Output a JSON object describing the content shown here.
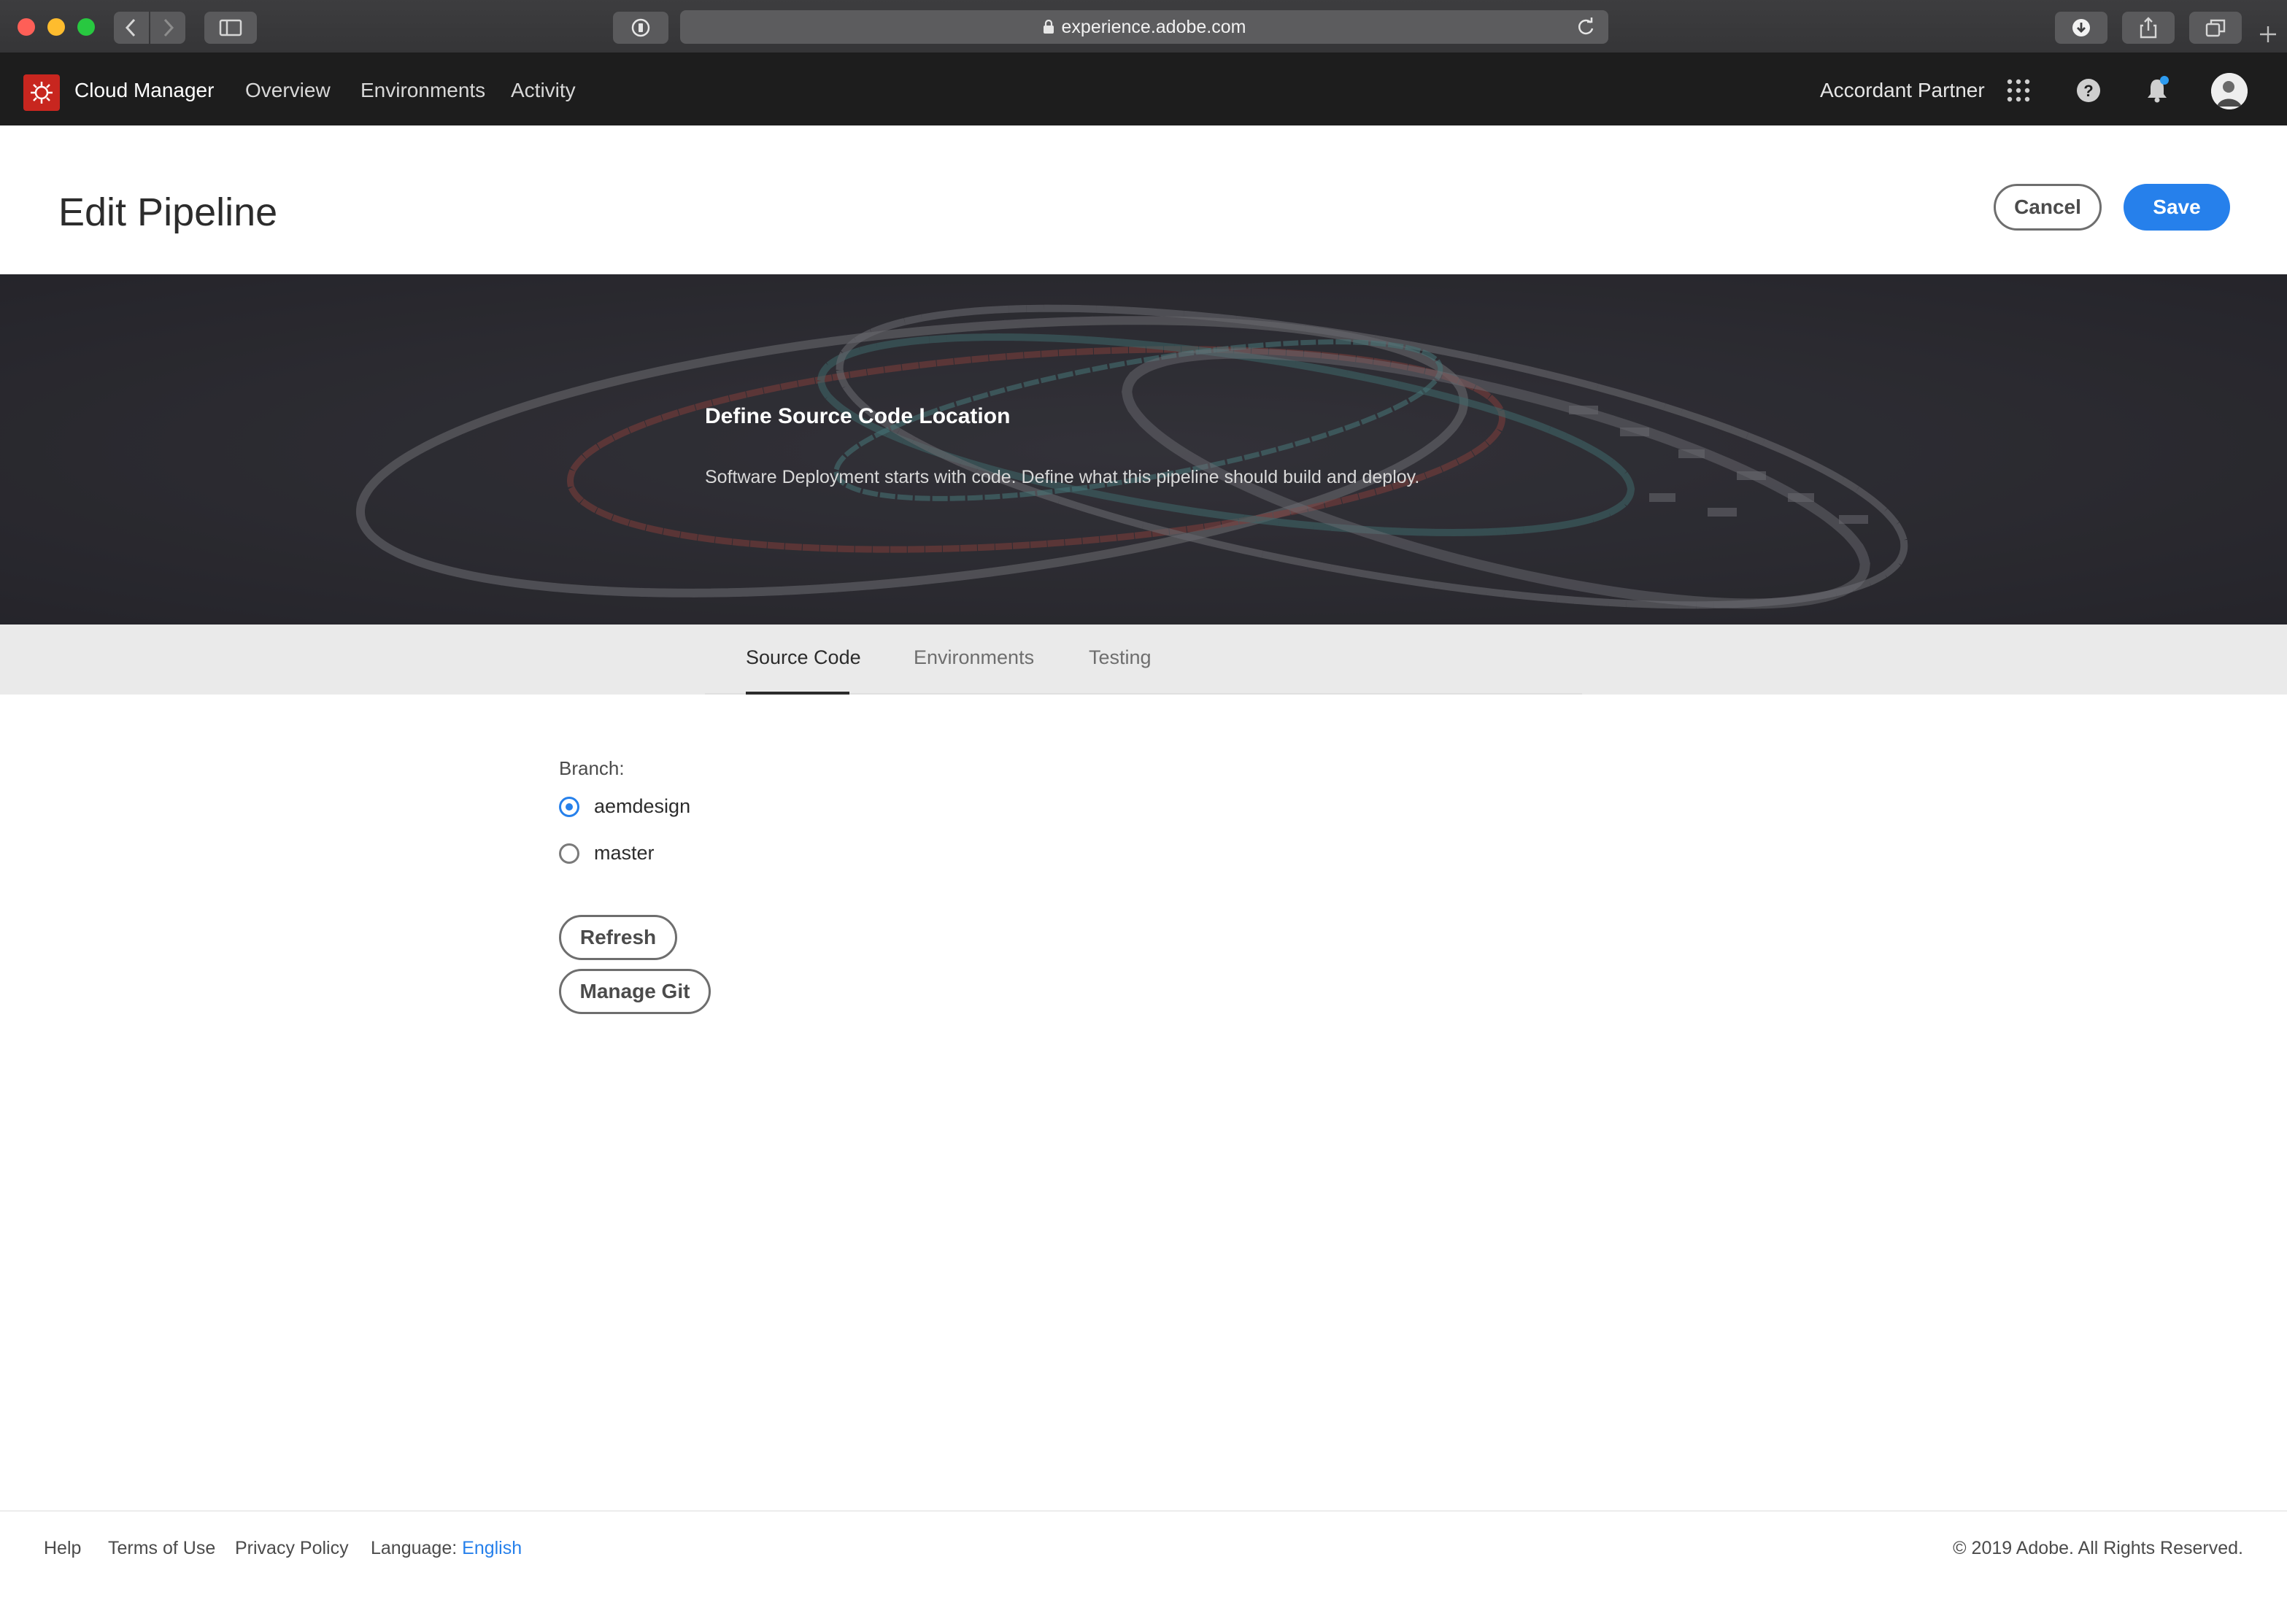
{
  "browser": {
    "url": "experience.adobe.com"
  },
  "app_nav": {
    "app_name": "Cloud Manager",
    "links": [
      "Overview",
      "Environments",
      "Activity"
    ],
    "org_name": "Accordant Partner",
    "icons": [
      "apps-grid-icon",
      "help-icon",
      "bell-icon",
      "avatar"
    ]
  },
  "header": {
    "title": "Edit Pipeline",
    "cancel_label": "Cancel",
    "save_label": "Save"
  },
  "hero": {
    "title": "Define Source Code Location",
    "subtitle": "Software Deployment starts with code. Define what this pipeline should build and deploy."
  },
  "tabs": [
    {
      "label": "Source Code",
      "active": true
    },
    {
      "label": "Environments",
      "active": false
    },
    {
      "label": "Testing",
      "active": false
    }
  ],
  "form": {
    "branch_label": "Branch:",
    "branches": [
      {
        "name": "aemdesign",
        "selected": true
      },
      {
        "name": "master",
        "selected": false
      }
    ],
    "refresh_label": "Refresh",
    "manage_git_label": "Manage Git"
  },
  "footer": {
    "help": "Help",
    "terms": "Terms of Use",
    "privacy": "Privacy Policy",
    "language_label": "Language:",
    "language_value": "English",
    "copyright": "© 2019 Adobe. All Rights Reserved."
  },
  "colors": {
    "accent": "#2680eb",
    "nav_bg": "#1d1d1d",
    "logo_red": "#c8261f"
  }
}
